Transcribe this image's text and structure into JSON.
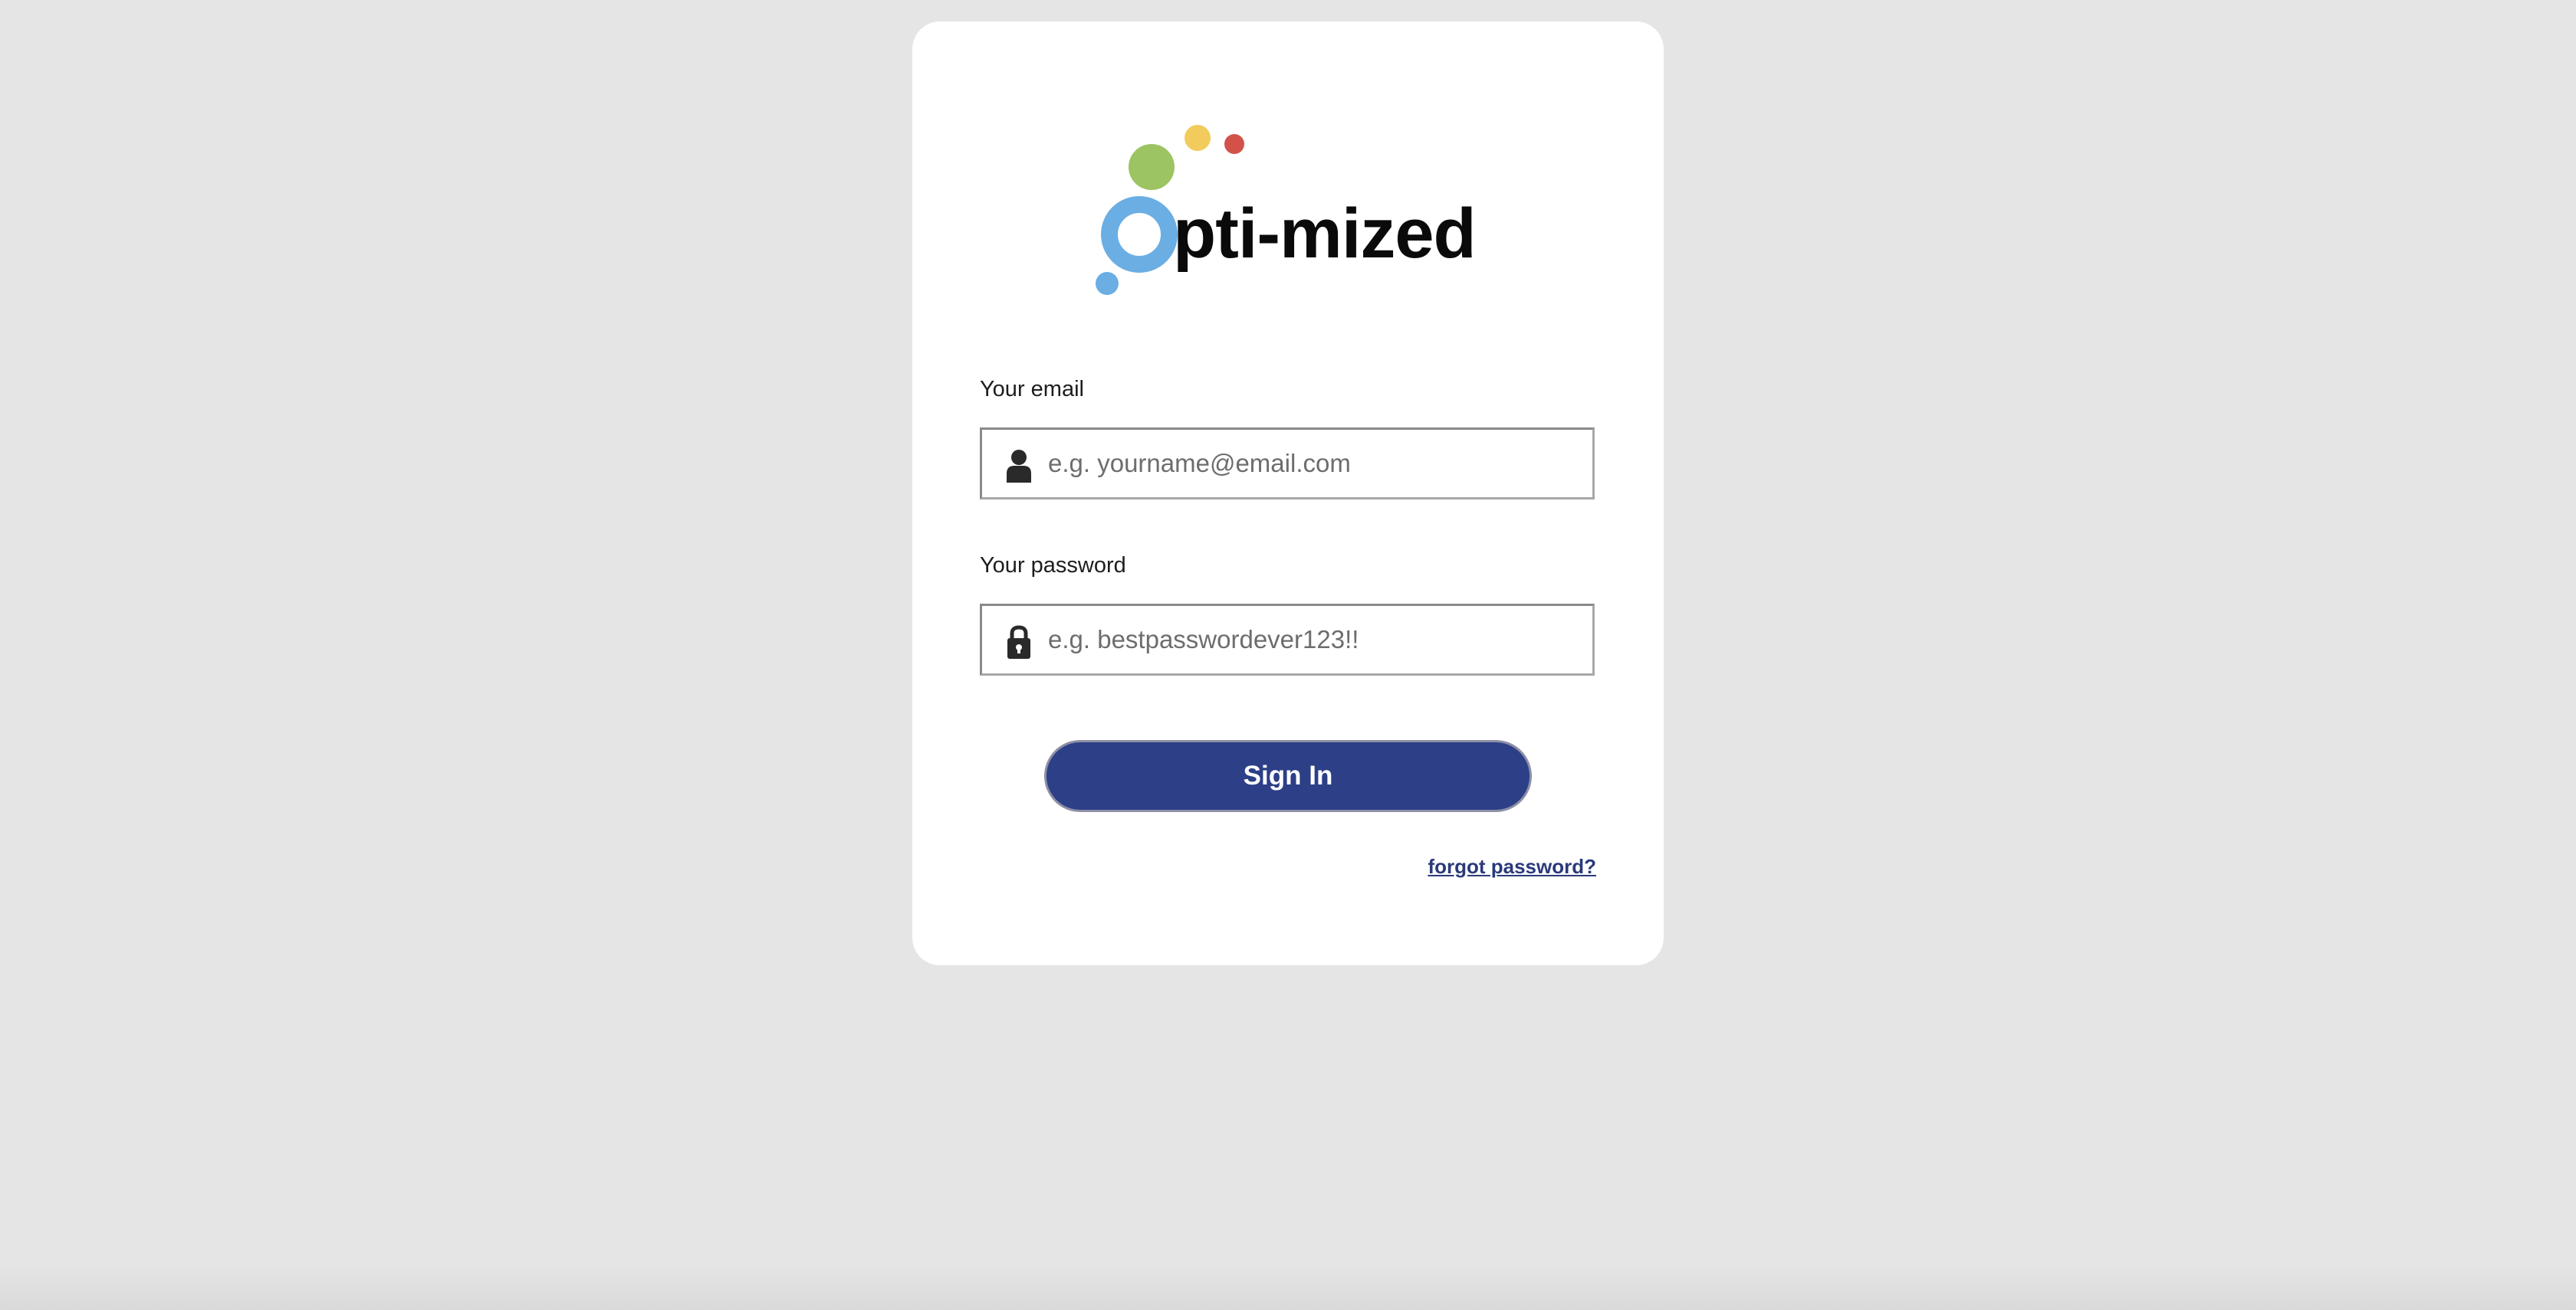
{
  "logo": {
    "text": "pti-mized",
    "colors": {
      "blue": "#6aaee3",
      "green": "#9cc462",
      "yellow": "#f1cb5b",
      "red": "#d2524a",
      "text": "#0a0a0a"
    }
  },
  "form": {
    "email": {
      "label": "Your email",
      "placeholder": "e.g. yourname@email.com",
      "value": "",
      "icon": "user-icon"
    },
    "password": {
      "label": "Your password",
      "placeholder": "e.g. bestpasswordever123!!",
      "value": "",
      "icon": "lock-icon"
    },
    "submit_label": "Sign In",
    "forgot_label": "forgot password?"
  },
  "theme": {
    "background": "#e5e5e5",
    "card": "#ffffff",
    "accent": "#2c3f87"
  }
}
